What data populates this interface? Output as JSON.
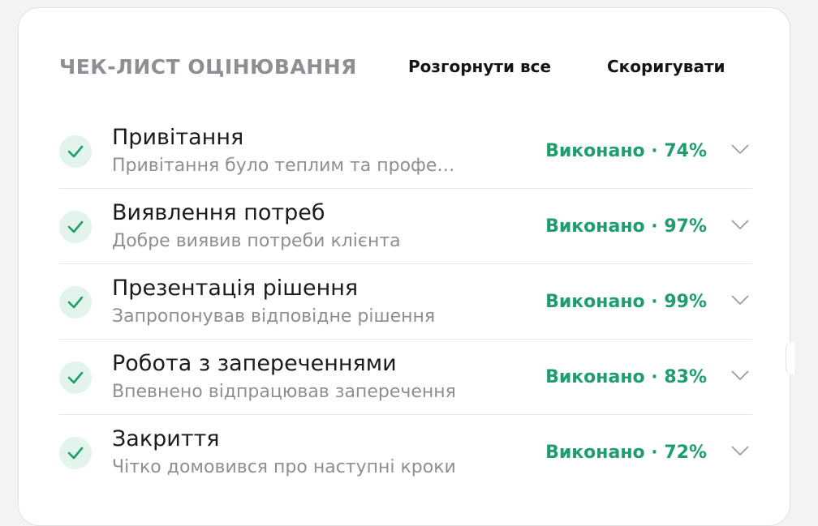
{
  "header": {
    "title": "ЧЕК-ЛИСТ ОЦІНЮВАННЯ",
    "expand_all_label": "Розгорнути все",
    "edit_label": "Скоригувати"
  },
  "colors": {
    "accent_green": "#1f9d6c",
    "check_bg": "#e3f4ec"
  },
  "items": [
    {
      "title": "Привітання",
      "description": "Привітання було теплим та профе…",
      "status": "Виконано · 74%",
      "icon": "check-icon"
    },
    {
      "title": "Виявлення потреб",
      "description": "Добре виявив потреби клієнта",
      "status": "Виконано · 97%",
      "icon": "check-icon"
    },
    {
      "title": "Презентація рішення",
      "description": "Запропонував відповідне рішення",
      "status": "Виконано · 99%",
      "icon": "check-icon"
    },
    {
      "title": "Робота з запереченнями",
      "description": "Впевнено відпрацював заперечення",
      "status": "Виконано · 83%",
      "icon": "check-icon"
    },
    {
      "title": "Закриття",
      "description": "Чітко домовився про наступні кроки",
      "status": "Виконано · 72%",
      "icon": "check-icon"
    }
  ]
}
